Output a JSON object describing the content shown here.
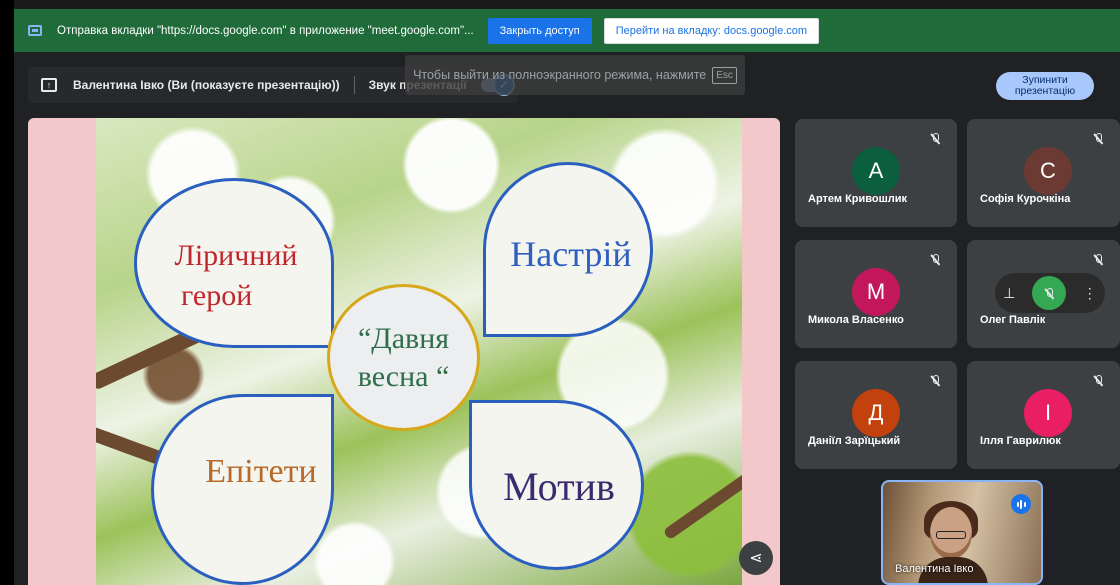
{
  "share_bar": {
    "message": "Отправка вкладки \"https://docs.google.com\" в приложение \"meet.google.com\"...",
    "close_access_label": "Закрыть доступ",
    "goto_tab_label": "Перейти на вкладку: docs.google.com"
  },
  "fullscreen_hint": {
    "text": "Чтобы выйти из полноэкранного режима, нажмите",
    "key": "Esc"
  },
  "presenter_bar": {
    "presenter_name": "Валентина Івко (Ви (показуєте презентацію))",
    "sound_label": "Звук презентації",
    "sound_enabled": true
  },
  "stop_presentation": {
    "line1": "Зупинити",
    "line2": "презентацію"
  },
  "slide": {
    "petal_top_left_line1": "Ліричний",
    "petal_top_left_line2": "герой",
    "petal_top_right": "Настрій",
    "petal_bottom_left": "Епітети",
    "petal_bottom_right": "Мотив",
    "center_line1": "“Давня",
    "center_line2": "весна “",
    "colors": {
      "petal_top_left_text": "#c0262d",
      "petal_top_right_text": "#2f5fbf",
      "petal_bottom_left_text": "#b86a2a",
      "petal_bottom_right_text": "#3a2a6e",
      "center_text": "#2f6e4a",
      "petal_border": "#2a5fbf",
      "center_border": "#d6a81a"
    }
  },
  "participants": [
    {
      "initial": "А",
      "name": "Артем Кривошлик",
      "color": "#0b5e3e",
      "muted": true
    },
    {
      "initial": "С",
      "name": "Софія Курочкіна",
      "color": "#6b3a33",
      "muted": true
    },
    {
      "initial": "М",
      "name": "Микола Власенко",
      "color": "#c2185b",
      "muted": true
    },
    {
      "initial": "",
      "name": "Олег Павлік",
      "color": "#3c4043",
      "muted": true
    },
    {
      "initial": "Д",
      "name": "Даніїл Зарїцький",
      "color": "#c2410c",
      "muted": true
    },
    {
      "initial": "І",
      "name": "Ілля Гаврилюк",
      "color": "#e91e63",
      "muted": true
    }
  ],
  "self_tile": {
    "name": "Валентина Івко"
  },
  "icons": {
    "share_tab": "present-to-all-icon",
    "present": "present-icon",
    "mic_off": "mic-off-icon",
    "pin": "pin-icon",
    "more": "more-vert-icon",
    "share": "share-icon",
    "speaking": "audio-level-icon"
  }
}
